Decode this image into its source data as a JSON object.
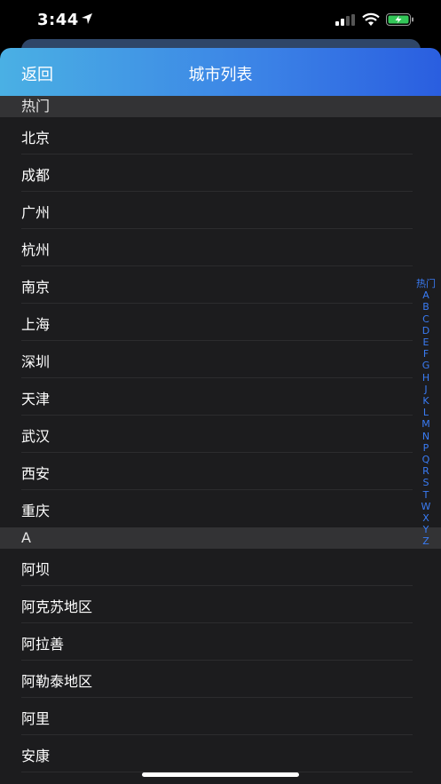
{
  "status_bar": {
    "time": "3:44"
  },
  "nav": {
    "back_label": "返回",
    "title": "城市列表"
  },
  "sections": [
    {
      "header": "热门",
      "items": [
        "北京",
        "成都",
        "广州",
        "杭州",
        "南京",
        "上海",
        "深圳",
        "天津",
        "武汉",
        "西安",
        "重庆"
      ]
    },
    {
      "header": "A",
      "items": [
        "阿坝",
        "阿克苏地区",
        "阿拉善",
        "阿勒泰地区",
        "阿里",
        "安康"
      ]
    }
  ],
  "index_letters": [
    "热门",
    "A",
    "B",
    "C",
    "D",
    "E",
    "F",
    "G",
    "H",
    "J",
    "K",
    "L",
    "M",
    "N",
    "P",
    "Q",
    "R",
    "S",
    "T",
    "W",
    "X",
    "Y",
    "Z"
  ],
  "colors": {
    "accent": "#3a7cf5",
    "background": "#1c1c1e",
    "section": "#333335",
    "nav_start": "#4ab0e4",
    "nav_end": "#2a5ee0"
  }
}
